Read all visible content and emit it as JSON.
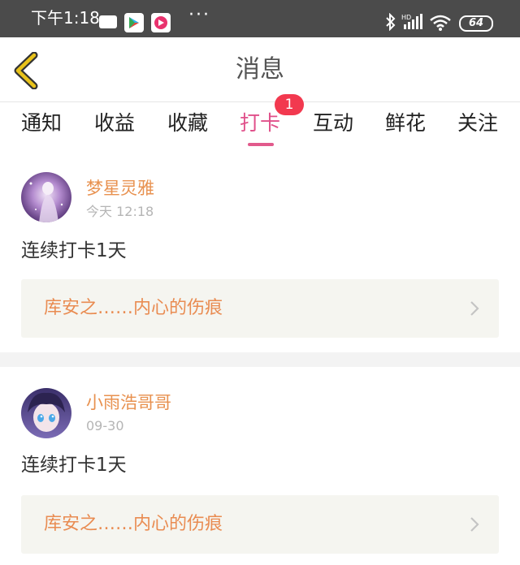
{
  "status_bar": {
    "time": "下午1:18",
    "dots": "···",
    "battery": "64",
    "icons": [
      "message-icon",
      "play-store-icon",
      "video-app-icon",
      "bluetooth-icon",
      "signal-icon",
      "wifi-icon",
      "battery-icon"
    ]
  },
  "header": {
    "title": "消息",
    "back_icon": "chevron-left-icon",
    "accent": "#e8c21a"
  },
  "tabs": {
    "items": [
      {
        "label": "通知"
      },
      {
        "label": "收益"
      },
      {
        "label": "收藏"
      },
      {
        "label": "打卡",
        "active": true
      },
      {
        "label": "互动"
      },
      {
        "label": "鲜花"
      },
      {
        "label": "关注"
      }
    ],
    "badge": "1",
    "active_color": "#e0508a",
    "badge_color": "#f2394f"
  },
  "messages": [
    {
      "username": "梦星灵雅",
      "time": "今天 12:18",
      "content": "连续打卡1天",
      "link_text": "库安之……内心的伤痕"
    },
    {
      "username": "小雨浩哥哥",
      "time": "09-30",
      "content": "连续打卡1天",
      "link_text": "库安之……内心的伤痕"
    }
  ],
  "colors": {
    "username": "#e8914f",
    "link_text": "#e98c52",
    "link_bg": "#f5f5f0"
  }
}
